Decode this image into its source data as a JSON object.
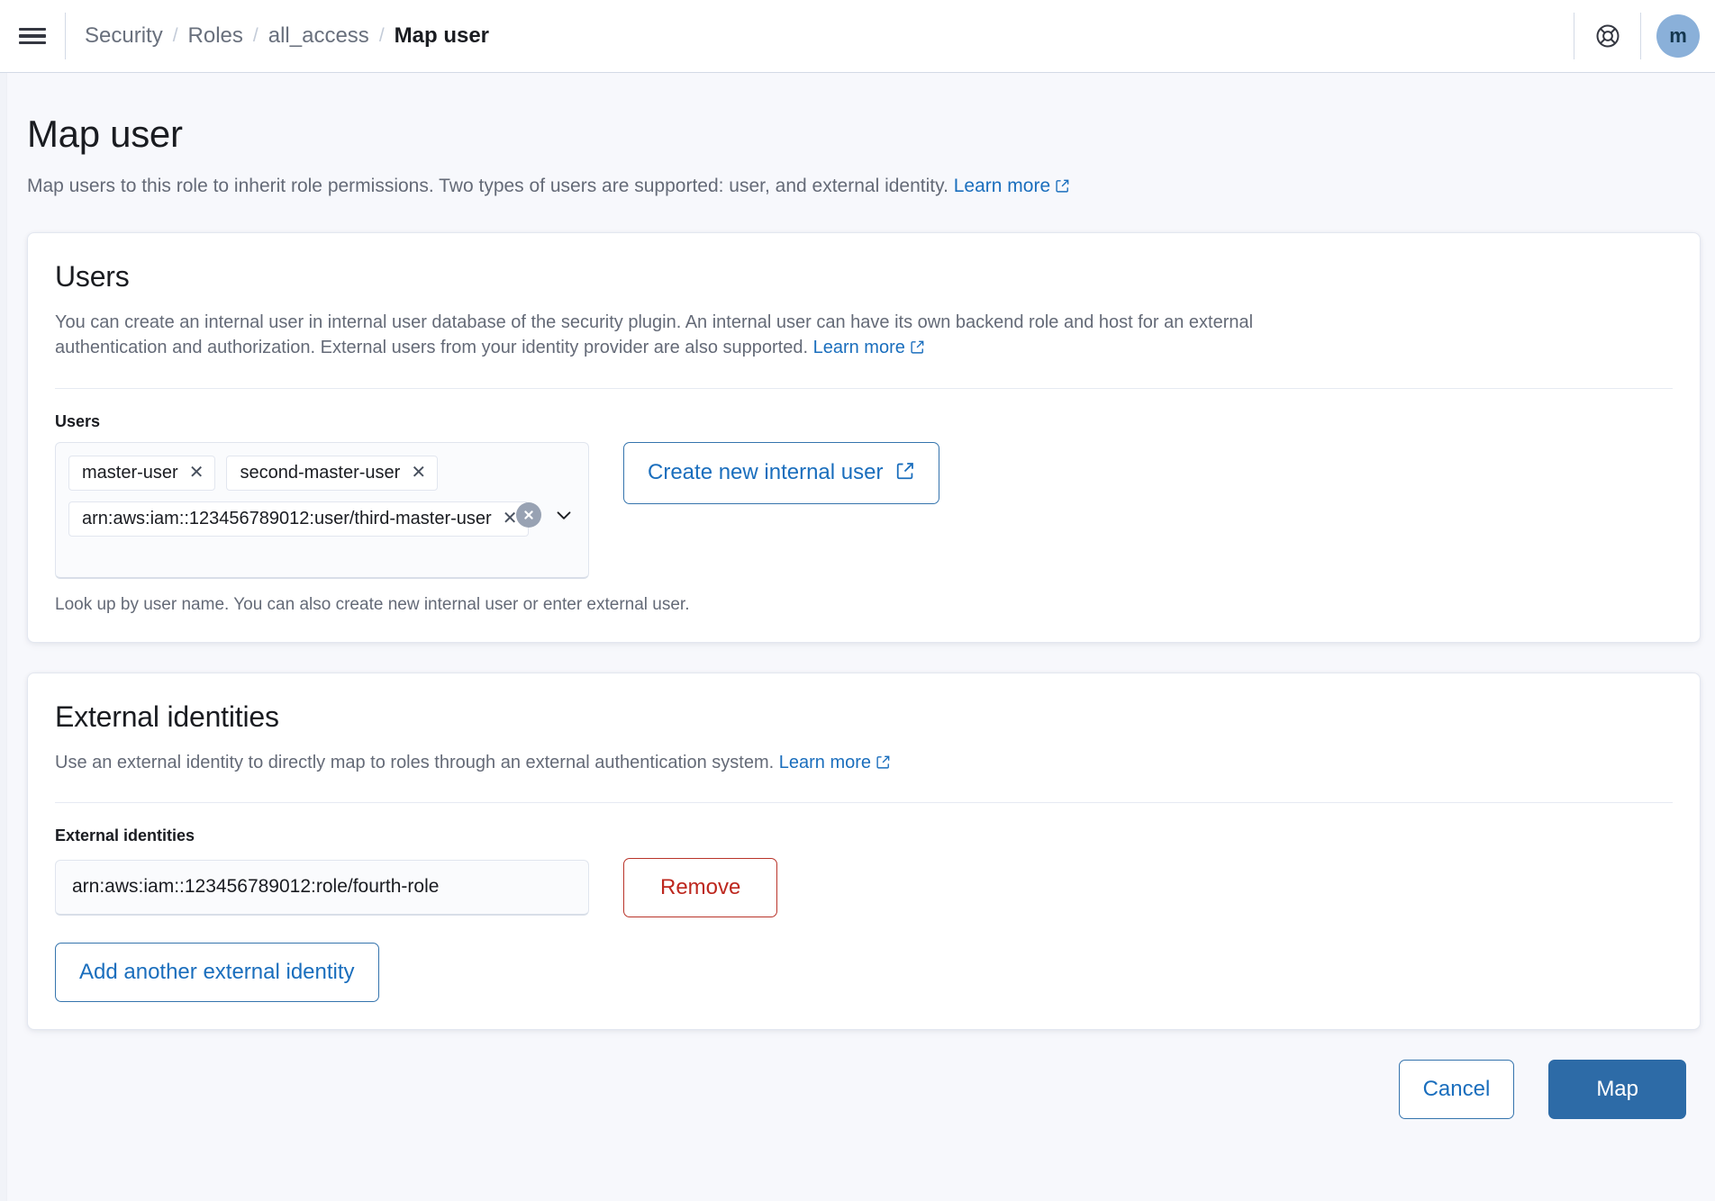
{
  "topbar": {
    "menu_icon": "hamburger-menu-icon",
    "breadcrumbs": [
      {
        "label": "Security",
        "current": false
      },
      {
        "label": "Roles",
        "current": false
      },
      {
        "label": "all_access",
        "current": false
      },
      {
        "label": "Map user",
        "current": true
      }
    ],
    "separator": "/",
    "help_icon": "lifebuoy-help-icon",
    "avatar_initial": "m",
    "avatar_color": "#8ab0d9"
  },
  "page": {
    "title": "Map user",
    "description": "Map users to this role to inherit role permissions. Two types of users are supported: user, and external identity.",
    "learn_more": "Learn more"
  },
  "users_card": {
    "title": "Users",
    "description": "You can create an internal user in internal user database of the security plugin. An internal user can have its own backend role and host for an external authentication and authorization. External users from your identity provider are also supported.",
    "learn_more": "Learn more",
    "field_label": "Users",
    "selected_users": [
      "master-user",
      "second-master-user",
      "arn:aws:iam::123456789012:user/third-master-user"
    ],
    "remove_glyph": "✕",
    "clear_all_icon": "clear-all-circle-icon",
    "dropdown_icon": "chevron-down-icon",
    "combo_placeholder": "",
    "help_text": "Look up by user name. You can also create new internal user or enter external user.",
    "create_user_button": "Create new internal user"
  },
  "external_card": {
    "title": "External identities",
    "description": "Use an external identity to directly map to roles through an external authentication system.",
    "learn_more": "Learn more",
    "field_label": "External identities",
    "identities": [
      {
        "value": "arn:aws:iam::123456789012:role/fourth-role",
        "placeholder": "",
        "remove_label": "Remove"
      }
    ],
    "add_button": "Add another external identity"
  },
  "footer": {
    "cancel_label": "Cancel",
    "map_label": "Map",
    "primary_color": "#2d6ba7"
  }
}
